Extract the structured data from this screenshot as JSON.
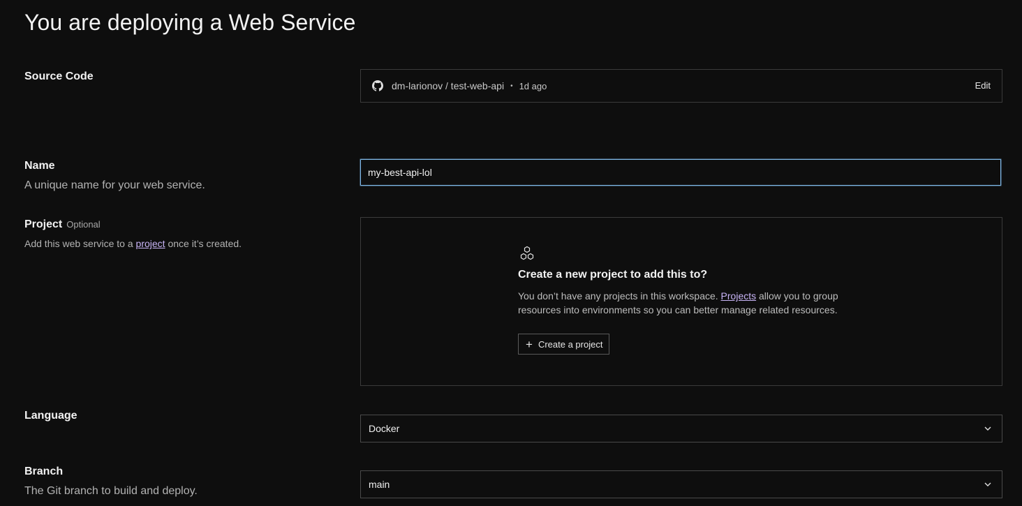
{
  "page": {
    "title": "You are deploying a Web Service"
  },
  "source_code": {
    "label": "Source Code",
    "repo": "dm-larionov / test-web-api",
    "separator": "•",
    "updated": "1d ago",
    "edit_label": "Edit",
    "icon": "github-icon"
  },
  "name": {
    "label": "Name",
    "hint": "A unique name for your web service.",
    "value": "my-best-api-lol"
  },
  "project": {
    "label": "Project",
    "optional_tag": "Optional",
    "hint_before": "Add this web service to a ",
    "hint_link": "project",
    "hint_after": " once it’s created.",
    "empty_icon": "hexagons-icon",
    "empty_title": "Create a new project to add this to?",
    "empty_desc_before": "You don’t have any projects in this workspace. ",
    "empty_desc_link": "Projects",
    "empty_desc_after": " allow you to group resources into environments so you can better manage related resources.",
    "create_button": "Create a project",
    "create_icon": "plus-icon"
  },
  "language": {
    "label": "Language",
    "value": "Docker"
  },
  "branch": {
    "label": "Branch",
    "hint": "The Git branch to build and deploy.",
    "value": "main"
  },
  "colors": {
    "background": "#0e0e0e",
    "link": "#c9b5f7",
    "focus_border": "#7fb8e8",
    "border": "#3b3b3b"
  }
}
